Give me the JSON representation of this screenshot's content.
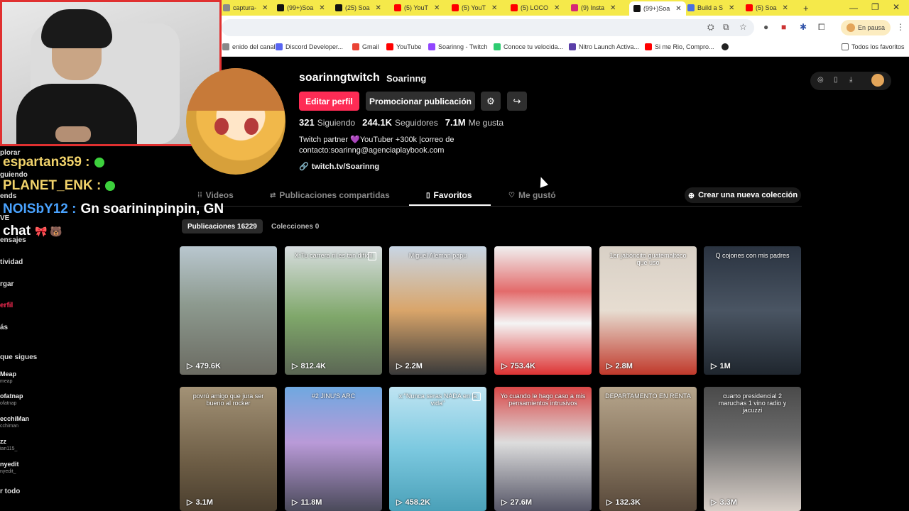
{
  "browser": {
    "tabs": [
      {
        "label": "captura-",
        "color": "#8a8a8a"
      },
      {
        "label": "(99+)Soa",
        "color": "#111111"
      },
      {
        "label": "(25) Soa",
        "color": "#111111"
      },
      {
        "label": "(5) YouT",
        "color": "#ff0000"
      },
      {
        "label": "(5) YouT",
        "color": "#ff0000"
      },
      {
        "label": "(5) LOCO",
        "color": "#ff0000"
      },
      {
        "label": "(9) Insta",
        "color": "#d62976"
      },
      {
        "label": "(99+)Soa",
        "color": "#111111"
      },
      {
        "label": "Build a S",
        "color": "#4a6fe3"
      },
      {
        "label": "(5) Soa",
        "color": "#ff0000"
      }
    ],
    "new_tab": "+",
    "pause_label": "En pausa",
    "bookmarks": [
      {
        "label": "enido del canal...",
        "color": "#888888"
      },
      {
        "label": "Discord Developer...",
        "color": "#5865f2"
      },
      {
        "label": "Gmail",
        "color": "#ea4335"
      },
      {
        "label": "YouTube",
        "color": "#ff0000"
      },
      {
        "label": "Soarinng - Twitch",
        "color": "#9146ff"
      },
      {
        "label": "Conoce tu velocida...",
        "color": "#2ecc71"
      },
      {
        "label": "Nitro Launch Activa...",
        "color": "#5b3fa8"
      },
      {
        "label": "Si me Rio, Compro...",
        "color": "#ff0000"
      }
    ],
    "all_favorites": "Todos los favoritos"
  },
  "overlay": {
    "nav": [
      "plorar",
      "guiendo",
      "ends",
      "VE",
      "ensajes",
      "tividad",
      "rgar",
      "erfil",
      "ás"
    ],
    "following_title": "que sigues",
    "following": [
      {
        "name": "Meap",
        "sub": "meap"
      },
      {
        "name": "ofatnap",
        "sub": "ofatnap"
      },
      {
        "name": "ecchiMan",
        "sub": "cchiman"
      },
      {
        "name": "zz",
        "sub": "ian115_"
      },
      {
        "name": "nyedit",
        "sub": "nyedit_"
      }
    ],
    "see_all": "r todo",
    "chat": [
      {
        "text": "espartan359 :",
        "color": "#f2d36b",
        "dot": true
      },
      {
        "text": "PLANET_ENK :",
        "color": "#f2d36b",
        "dot": true
      },
      {
        "text": "NOISbY12 :",
        "color": "#4aa3ff",
        "msg": "Gn soarininpinpin, GN"
      },
      {
        "text": "chat",
        "color": "#ffffff",
        "emotes": "🎀 🐻"
      }
    ]
  },
  "profile": {
    "username": "soarinngtwitch",
    "nickname": "Soarinng",
    "edit_button": "Editar perfil",
    "promote_button": "Promocionar publicación",
    "following_count": "321",
    "following_label": "Siguiendo",
    "followers_count": "244.1K",
    "followers_label": "Seguidores",
    "likes_count": "7.1M",
    "likes_label": "Me gusta",
    "bio_line1": "Twitch partner 💜YouTuber +300k |correo de",
    "bio_line2": "contacto:soarinng@agenciaplaybook.com",
    "link": "twitch.tv/Soarinng"
  },
  "profile_tabs": [
    {
      "label": "Videos",
      "icon": "grid-icon"
    },
    {
      "label": "Publicaciones compartidas",
      "icon": "repost-icon"
    },
    {
      "label": "Favoritos",
      "icon": "bookmark-icon"
    },
    {
      "label": "Me gustó",
      "icon": "heart-icon"
    }
  ],
  "new_collection": "Crear una nueva colección",
  "chips": {
    "posts": "Publicaciones 16229",
    "collections": "Colecciones 0"
  },
  "grid": [
    {
      "caption": "",
      "views": "479.6K",
      "bg": "linear-gradient(180deg,#b9c7cf 0%,#8d9a8f 45%,#6b6b62 100%)"
    },
    {
      "caption": "X:Tu carrera ni es tan difícil",
      "views": "812.4K",
      "bg": "linear-gradient(180deg,#d8dde0 0%,#7fa76a 55%,#5b6654 100%)",
      "multi": true
    },
    {
      "caption": "Miguel Aleman papu",
      "views": "2.2M",
      "bg": "linear-gradient(180deg,#c8d6e5 0%,#d9a56a 50%,#3a3a3a 100%)"
    },
    {
      "caption": "",
      "views": "753.4K",
      "bg": "linear-gradient(180deg,#f0f0f0 0%,#e36b6b 35%,#f4f4f4 60%,#d33 100%)"
    },
    {
      "caption": "1er jabóncito guatemalteco que uso",
      "views": "2.8M",
      "bg": "linear-gradient(180deg,#d8d0c6 0%,#e7ddd1 50%,#c0392b 100%)"
    },
    {
      "caption": "Q cojones con mis padres",
      "views": "1M",
      "bg": "linear-gradient(180deg,#2a3340 0%,#4a5563 50%,#1f262e 100%)"
    },
    {
      "caption": "povrú amigo que jura ser bueno al rocker",
      "views": "3.1M",
      "bg": "linear-gradient(180deg,#a39276 0%,#6e5e46 60%,#4a3e2e 100%)"
    },
    {
      "caption": "#2 JINU'S ARC",
      "views": "11.8M",
      "bg": "linear-gradient(180deg,#6fa8e0 0%,#b99ad8 45%,#4a4a5a 100%)"
    },
    {
      "caption": "x:\"Nunca seras NADA en la vida\"",
      "views": "458.2K",
      "bg": "linear-gradient(180deg,#bfe4f2 0%,#7cc9e0 50%,#4aa0b8 100%)",
      "multi": true
    },
    {
      "caption": "Yo cuando le hago caso a mis pensamientos intrusivos",
      "views": "27.6M",
      "bg": "linear-gradient(180deg,#d94848 0%,#ddd 45%,#556 100%)"
    },
    {
      "caption": "DEPARTAMENTO EN RENTA",
      "views": "132.3K",
      "bg": "linear-gradient(180deg,#b6a58c 0%,#8c7a63 50%,#57483a 100%)"
    },
    {
      "caption": "cuarto presidencial 2 maruchas 1 vino radio y jacuzzi",
      "views": "3.3M",
      "bg": "linear-gradient(180deg,#4a4a4a 0%,#6a6a6a 40%,#d8cfc8 100%)"
    }
  ]
}
